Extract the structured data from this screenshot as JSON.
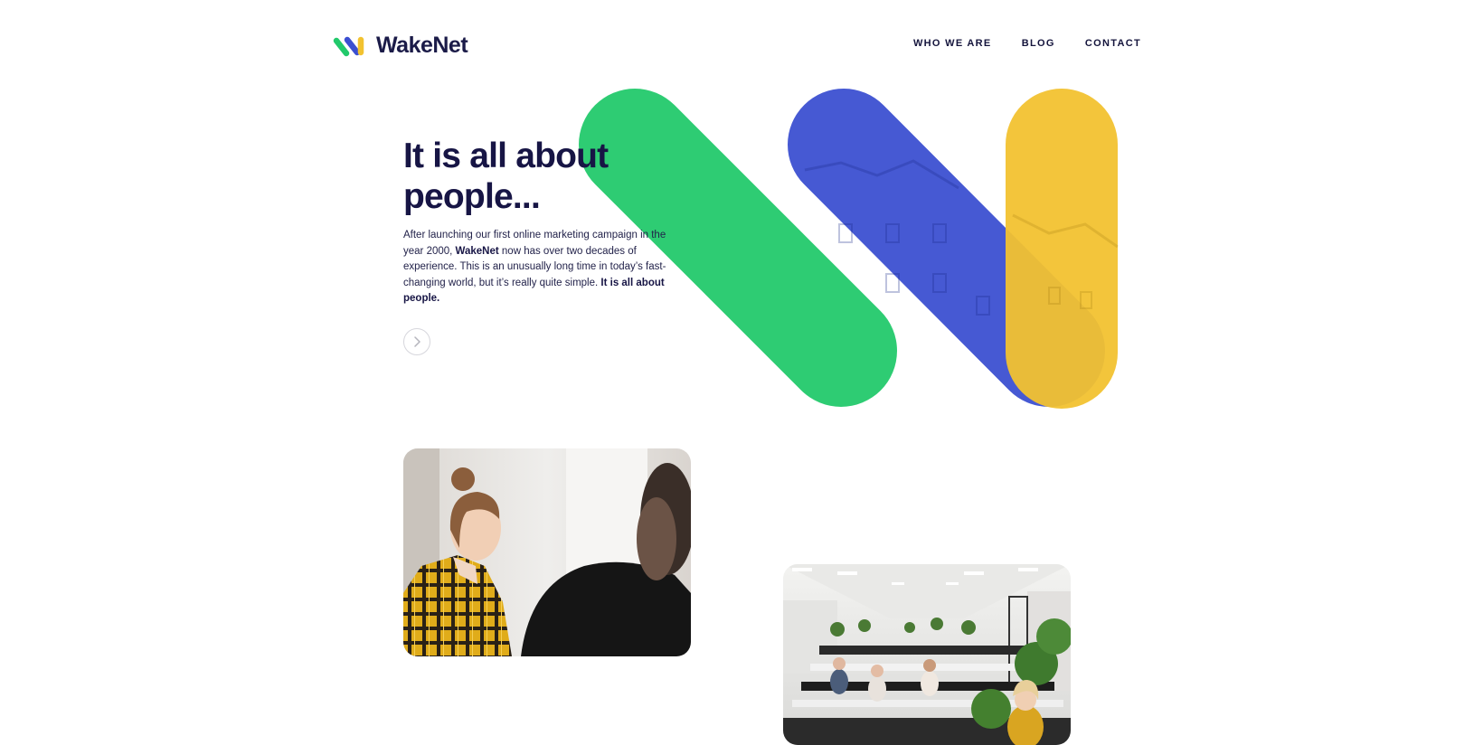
{
  "header": {
    "brand": "WakeNet",
    "nav": [
      {
        "label": "WHO WE ARE"
      },
      {
        "label": "BLOG"
      },
      {
        "label": "CONTACT"
      }
    ]
  },
  "hero": {
    "title_line1": "It is all about",
    "title_line2": "people...",
    "desc_part1": "After launching our first online marketing campaign in the year 2000, ",
    "desc_brand": "WakeNet",
    "desc_part2": " now has over two decades of experience. This is an unusually long time in today’s fast-changing world, but it’s really quite simple. ",
    "desc_emphasis": "It is all about people.",
    "next_icon": "chevron-right-icon"
  },
  "brand_colors": {
    "navy": "#171545",
    "green": "#22c96b",
    "blue": "#3b4fd1",
    "yellow": "#f2c230"
  },
  "photos": [
    {
      "subject": "woman in yellow plaid jacket talking to colleague"
    },
    {
      "subject": "open-plan office with people at desks"
    }
  ]
}
